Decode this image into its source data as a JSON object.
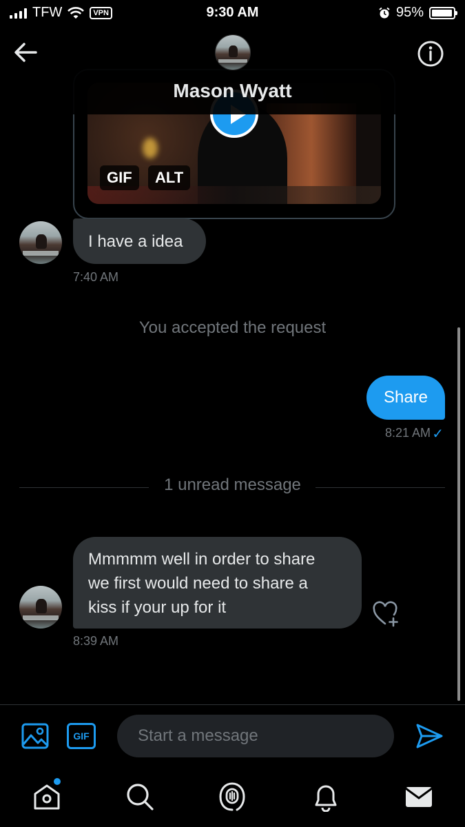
{
  "status_bar": {
    "carrier": "TFW",
    "vpn_label": "VPN",
    "time": "9:30 AM",
    "battery": "95%",
    "battery_level": 0.95
  },
  "header": {
    "contact_name": "Mason Wyatt"
  },
  "media": {
    "gif_badge": "GIF",
    "alt_badge": "ALT"
  },
  "messages": [
    {
      "direction": "incoming",
      "text": "I have a idea",
      "time": "7:40 AM"
    },
    {
      "direction": "outgoing",
      "text": "Share",
      "time": "8:21 AM",
      "status": "✓"
    },
    {
      "direction": "incoming",
      "lines": [
        "Mmmmm well in order to share",
        "we first would need to share a",
        "kiss if your up for it"
      ],
      "time": "8:39 AM"
    }
  ],
  "system": {
    "accepted": "You accepted the request",
    "unread": "1 unread message"
  },
  "composer": {
    "placeholder": "Start a message",
    "gif_label": "GIF"
  },
  "colors": {
    "accent": "#1d9bf0",
    "incoming_bubble": "#2f3336",
    "muted_text": "#71767b"
  },
  "icons": [
    "back-arrow-icon",
    "info-icon",
    "play-icon",
    "image-icon",
    "gif-icon",
    "send-icon",
    "home-icon",
    "search-icon",
    "spaces-icon",
    "notifications-icon",
    "messages-icon",
    "like-icon"
  ]
}
